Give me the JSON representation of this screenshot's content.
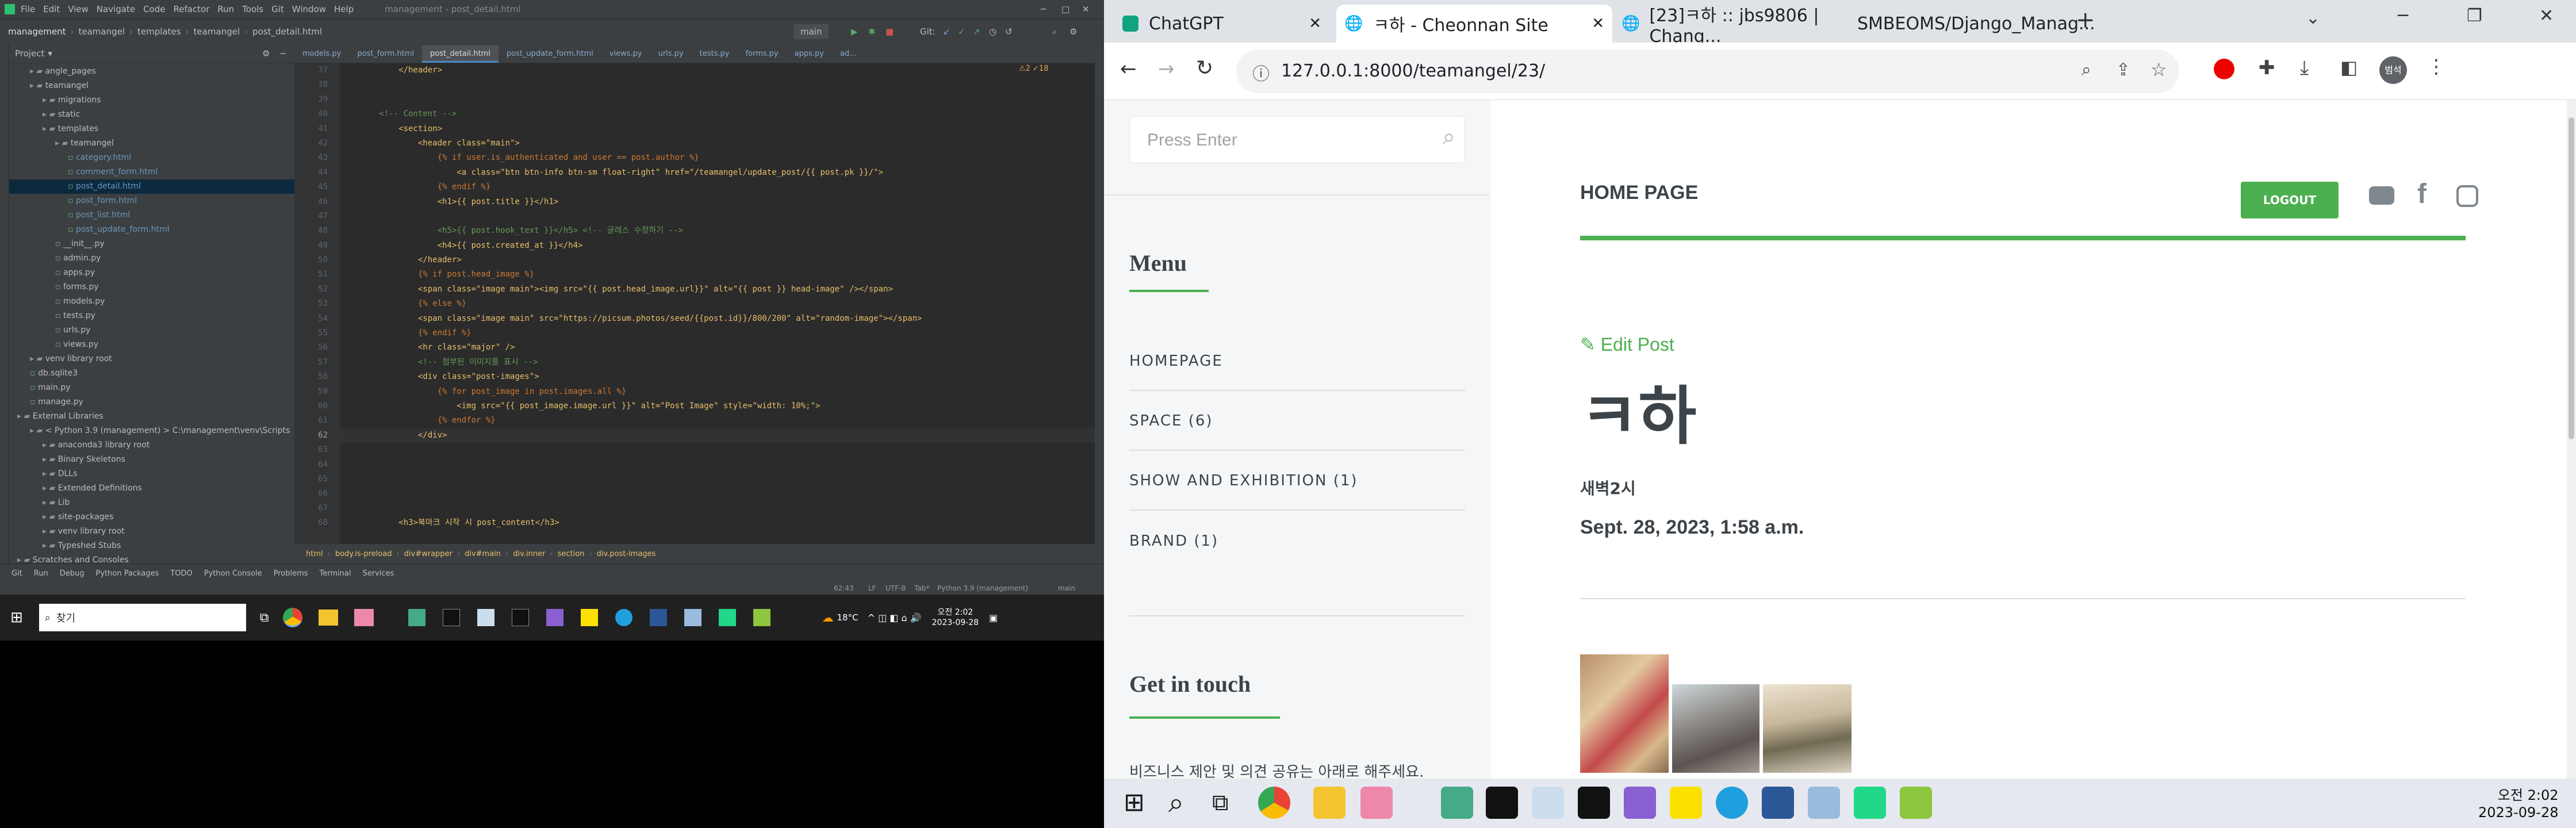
{
  "ide": {
    "menu": [
      "File",
      "Edit",
      "View",
      "Navigate",
      "Code",
      "Refactor",
      "Run",
      "Tools",
      "Git",
      "Window",
      "Help"
    ],
    "title": "management - post_detail.html",
    "breadcrumb_nav": [
      "management",
      "teamangel",
      "templates",
      "teamangel",
      "post_detail.html"
    ],
    "branch": "main",
    "git_label": "Git:",
    "project_label": "Project",
    "tree": [
      "angle_pages",
      "teamangel",
      "migrations",
      "static",
      "templates",
      "teamangel",
      "category.html",
      "comment_form.html",
      "post_detail.html",
      "post_form.html",
      "post_list.html",
      "post_update_form.html",
      "__init__.py",
      "admin.py",
      "apps.py",
      "forms.py",
      "models.py",
      "tests.py",
      "urls.py",
      "views.py",
      "venv  library root",
      "db.sqlite3",
      "main.py",
      "manage.py",
      "External Libraries",
      "< Python 3.9 (management) >  C:\\management\\venv\\Scripts",
      "anaconda3  library root",
      "Binary Skeletons",
      "DLLs",
      "Extended Definitions",
      "Lib",
      "site-packages",
      "venv  library root",
      "Typeshed Stubs",
      "Scratches and Consoles"
    ],
    "tabs": [
      "models.py",
      "post_form.html",
      "post_detail.html",
      "post_update_form.html",
      "views.py",
      "urls.py",
      "tests.py",
      "forms.py",
      "apps.py",
      "ad..."
    ],
    "warnings": "⚠2 ✓18",
    "line_numbers": [
      "37",
      "38",
      "39",
      "40",
      "41",
      "42",
      "43",
      "44",
      "45",
      "46",
      "47",
      "48",
      "49",
      "50",
      "51",
      "52",
      "53",
      "54",
      "55",
      "56",
      "57",
      "58",
      "59",
      "60",
      "61",
      "62",
      "63",
      "64",
      "65",
      "66",
      "67",
      "68"
    ],
    "code_lines": [
      "            </header>",
      "",
      "",
      "        <!-- Content -->",
      "            <section>",
      "                <header class=\"main\">",
      "                    {% if user.is_authenticated and user == post.author %}",
      "                        <a class=\"btn btn-info btn-sm float-right\" href=\"/teamangel/update_post/{{ post.pk }}/\">",
      "                    {% endif %}",
      "                    <h1>{{ post.title }}</h1>",
      "",
      "                    <h5>{{ post.hook_text }}</h5> <!-- 글레스 수정하기 -->",
      "                    <h4>{{ post.created_at }}</h4>",
      "                </header>",
      "                {% if post.head_image %}",
      "                <span class=\"image main\"><img src=\"{{ post.head_image.url}}\" alt=\"{{ post }} head-image\" /></span>",
      "                {% else %}",
      "                <span class=\"image main\" src=\"https://picsum.photos/seed/{{post.id}}/800/200\" alt=\"random-image\"></span>",
      "                {% endif %}",
      "                <hr class=\"major\" />",
      "                <!-- 첨부된 이미지를 표시 -->",
      "                <div class=\"post-images\">",
      "                    {% for post_image in post.images.all %}",
      "                        <img src=\"{{ post_image.image.url }}\" alt=\"Post Image\" style=\"width: 10%;\">",
      "                    {% endfor %}",
      "                </div>",
      "",
      "",
      "",
      "",
      "",
      "            <h3>북마크 시작 시 post_content</h3>"
    ],
    "bc_path": [
      "html",
      "body.is-preload",
      "div#wrapper",
      "div#main",
      "div.inner",
      "section",
      "div.post-images"
    ],
    "bottom_tools": [
      "Git",
      "Run",
      "Debug",
      "Python Packages",
      "TODO",
      "Python Console",
      "Problems",
      "Terminal",
      "Services"
    ],
    "status_right": [
      "62:43",
      "LF",
      "UTF-8",
      "Tab*",
      "Python 3.9 (management)",
      "main"
    ],
    "search_placeholder": "찾기",
    "weather": "18°C",
    "clock_time": "오전 2:02",
    "clock_date": "2023-09-28"
  },
  "browser": {
    "tabs": [
      "ChatGPT",
      "ㅋ하 - Cheonnan Site",
      "[23]ㅋ하 :: jbs9806 | Chang...",
      "SMBEOMS/Django_Manag..."
    ],
    "url": "127.0.0.1:8000/teamangel/23/",
    "profile": "범석"
  },
  "site": {
    "search_placeholder": "Press Enter",
    "menu_title": "Menu",
    "menu": [
      "HOMEPAGE",
      "SPACE (6)",
      "SHOW AND EXHIBITION (1)",
      "BRAND (1)"
    ],
    "touch_title": "Get in touch",
    "touch_text": "비즈니스 제안 및 의견 공유는 아래로 해주세요.",
    "home_page": "HOME PAGE",
    "logout": "LOGOUT",
    "edit": "Edit Post",
    "title": "ㅋ하",
    "hook": "새벽2시",
    "date": "Sept. 28, 2023, 1:58 a.m."
  },
  "taskbar": {
    "time": "오전 2:02",
    "date": "2023-09-28"
  },
  "colors": {
    "accent": "#4caf50",
    "ide_bg": "#2b2b2b",
    "ide_panel": "#3c3f41"
  }
}
